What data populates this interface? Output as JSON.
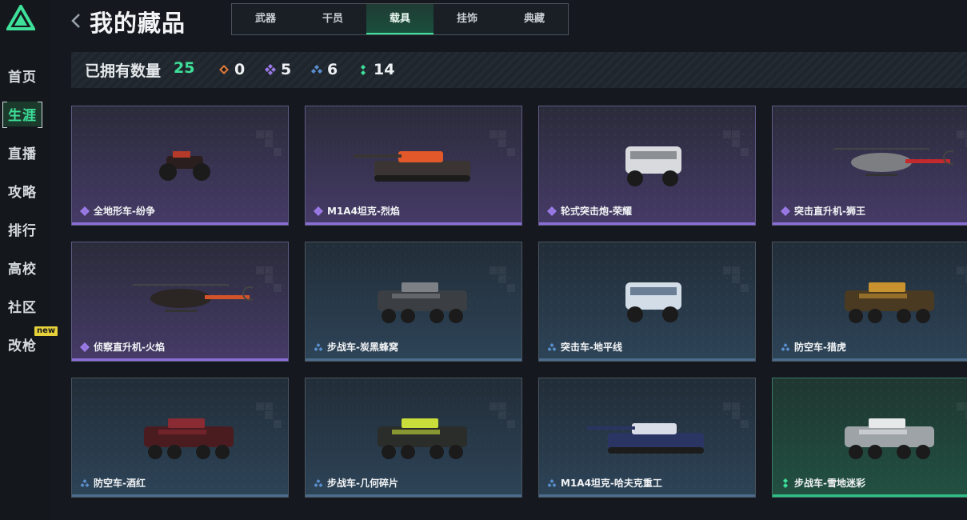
{
  "sidebar": {
    "items": [
      {
        "label": "首页"
      },
      {
        "label": "生涯"
      },
      {
        "label": "直播"
      },
      {
        "label": "攻略"
      },
      {
        "label": "排行"
      },
      {
        "label": "高校"
      },
      {
        "label": "社区"
      },
      {
        "label": "改枪"
      }
    ],
    "new_badge": "new",
    "active_index": 1
  },
  "header": {
    "title": "我的藏品",
    "tabs": [
      {
        "label": "武器"
      },
      {
        "label": "干员"
      },
      {
        "label": "载具"
      },
      {
        "label": "挂饰"
      },
      {
        "label": "典藏"
      }
    ],
    "active_tab": 2
  },
  "summary": {
    "owned_label": "已拥有数量",
    "owned_count": "25",
    "rarity_counts": [
      {
        "icon": "orange-diamond-icon",
        "color": "#d9783a",
        "count": "0"
      },
      {
        "icon": "purple-diamond-icon",
        "color": "#9a7ae6",
        "count": "5"
      },
      {
        "icon": "blue-diamond-icon",
        "color": "#5a8fcf",
        "count": "6"
      },
      {
        "icon": "green-dots-icon",
        "color": "#3ee09a",
        "count": "14"
      }
    ]
  },
  "vehicles": [
    {
      "name": "全地形车-纷争",
      "rarity": "purple"
    },
    {
      "name": "M1A4坦克-烈焰",
      "rarity": "purple"
    },
    {
      "name": "轮式突击炮-荣耀",
      "rarity": "purple"
    },
    {
      "name": "突击直升机-狮王",
      "rarity": "purple"
    },
    {
      "name": "侦察直升机-火焰",
      "rarity": "purple"
    },
    {
      "name": "步战车-炭黑蜂窝",
      "rarity": "blue"
    },
    {
      "name": "突击车-地平线",
      "rarity": "blue"
    },
    {
      "name": "防空车-猎虎",
      "rarity": "blue"
    },
    {
      "name": "防空车-酒红",
      "rarity": "blue"
    },
    {
      "name": "步战车-几何碎片",
      "rarity": "blue"
    },
    {
      "name": "M1A4坦克-哈夫克重工",
      "rarity": "blue"
    },
    {
      "name": "步战车-雪地迷彩",
      "rarity": "green"
    }
  ]
}
